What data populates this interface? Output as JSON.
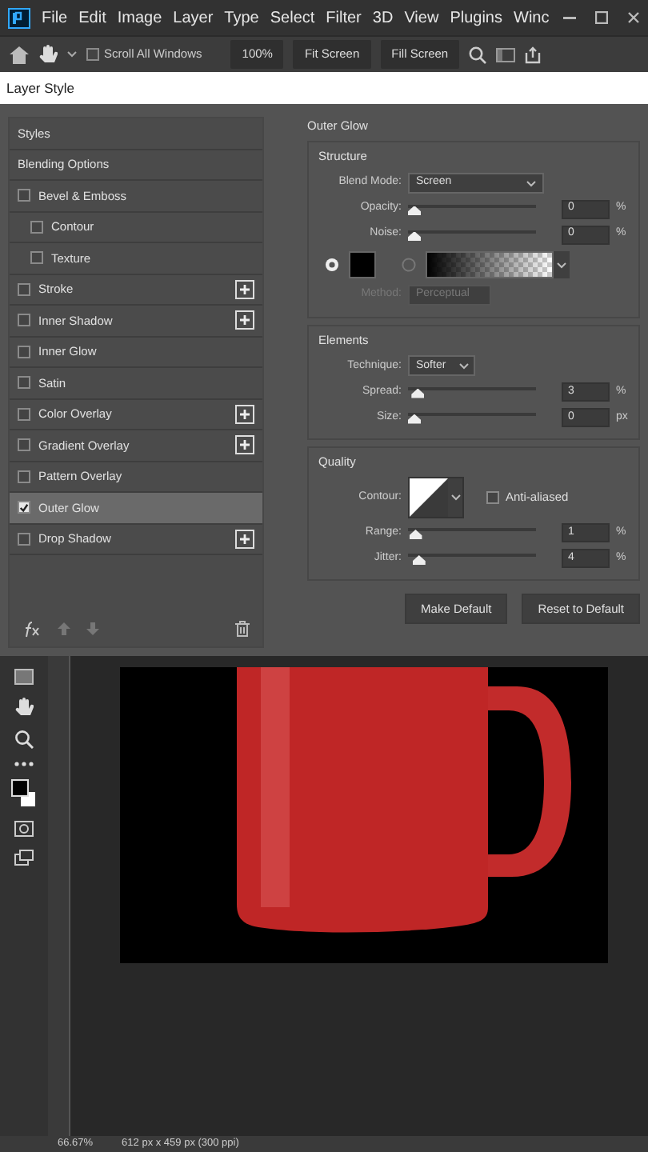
{
  "menu_bar": {
    "items": [
      "File",
      "Edit",
      "Image",
      "Layer",
      "Type",
      "Select",
      "Filter",
      "3D",
      "View",
      "Plugins",
      "Winc"
    ]
  },
  "options_bar": {
    "scroll_all_windows": {
      "label": "Scroll All Windows",
      "checked": false
    },
    "buttons": [
      "100%",
      "Fit Screen",
      "Fill Screen"
    ]
  },
  "dialog": {
    "title": "Layer Style",
    "styles": [
      {
        "kind": "header",
        "label": "Styles",
        "selected": false
      },
      {
        "kind": "header",
        "label": "Blending Options",
        "selected": false
      },
      {
        "kind": "check",
        "label": "Bevel & Emboss",
        "checked": false,
        "addable": false,
        "selected": false,
        "children": [
          {
            "kind": "check",
            "label": "Contour",
            "checked": false,
            "addable": false,
            "selected": false
          },
          {
            "kind": "check",
            "label": "Texture",
            "checked": false,
            "addable": false,
            "selected": false
          }
        ]
      },
      {
        "kind": "check",
        "label": "Stroke",
        "checked": false,
        "addable": true,
        "selected": false
      },
      {
        "kind": "check",
        "label": "Inner Shadow",
        "checked": false,
        "addable": true,
        "selected": false
      },
      {
        "kind": "check",
        "label": "Inner Glow",
        "checked": false,
        "addable": false,
        "selected": false
      },
      {
        "kind": "check",
        "label": "Satin",
        "checked": false,
        "addable": false,
        "selected": false
      },
      {
        "kind": "check",
        "label": "Color Overlay",
        "checked": false,
        "addable": true,
        "selected": false
      },
      {
        "kind": "check",
        "label": "Gradient Overlay",
        "checked": false,
        "addable": true,
        "selected": false
      },
      {
        "kind": "check",
        "label": "Pattern Overlay",
        "checked": false,
        "addable": false,
        "selected": false
      },
      {
        "kind": "check",
        "label": "Outer Glow",
        "checked": true,
        "addable": false,
        "selected": true
      },
      {
        "kind": "check",
        "label": "Drop Shadow",
        "checked": false,
        "addable": true,
        "selected": false
      }
    ],
    "panel": {
      "title": "Outer Glow",
      "structure": {
        "title": "Structure",
        "blend_mode": {
          "label": "Blend Mode:",
          "value": "Screen"
        },
        "sliders": [
          {
            "label": "Opacity:",
            "level": 0,
            "value": "0",
            "unit": "%"
          },
          {
            "label": "Noise:",
            "level": 0,
            "value": "0",
            "unit": "%"
          }
        ],
        "fill_options": [
          {
            "kind": "color",
            "selected": true
          },
          {
            "kind": "gradient",
            "selected": false
          }
        ],
        "method": {
          "label": "Method:",
          "value": "Perceptual",
          "disabled": true
        }
      },
      "elements": {
        "title": "Elements",
        "technique": {
          "label": "Technique:",
          "value": "Softer"
        },
        "sliders": [
          {
            "label": "Spread:",
            "level": 0.03,
            "value": "3",
            "unit": "%"
          },
          {
            "label": "Size:",
            "level": 0,
            "value": "0",
            "unit": "px"
          }
        ]
      },
      "quality": {
        "title": "Quality",
        "contour_label": "Contour:",
        "anti_aliased": {
          "label": "Anti-aliased",
          "checked": false
        },
        "sliders": [
          {
            "label": "Range:",
            "level": 0.01,
            "value": "1",
            "unit": "%"
          },
          {
            "label": "Jitter:",
            "level": 0.04,
            "value": "4",
            "unit": "%"
          }
        ]
      },
      "buttons": [
        "Make Default",
        "Reset to Default"
      ]
    }
  },
  "status_bar": {
    "zoom": "66.67%",
    "document_info": "612 px x 459 px (300 ppi)"
  }
}
